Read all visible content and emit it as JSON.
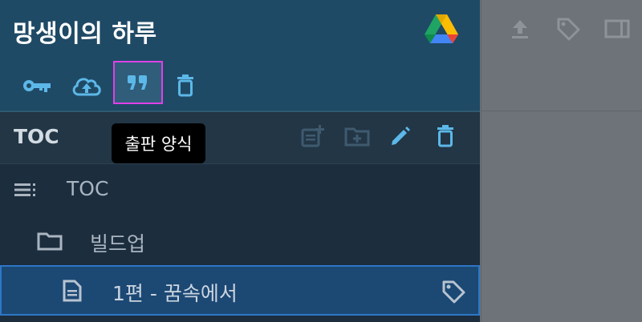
{
  "header": {
    "title": "망생이의 하루"
  },
  "toolbar": {
    "key_icon": "key-icon",
    "upload_icon": "cloud-upload-icon",
    "quote_icon": "format-quote-icon",
    "trash_icon": "trash-icon"
  },
  "tooltip": {
    "text": "출판 양식"
  },
  "toc": {
    "label": "TOC",
    "actions": [
      "note-plus-icon",
      "folder-plus-icon",
      "pencil-icon",
      "trash-icon"
    ]
  },
  "tree": {
    "items": [
      {
        "label": "TOC",
        "icon": "list-icon"
      },
      {
        "label": "빌드업",
        "icon": "folder-icon"
      },
      {
        "label": "1편 - 꿈속에서",
        "icon": "document-icon",
        "selected": true
      }
    ]
  },
  "right_toolbar": {
    "icons": [
      "upload-icon",
      "tag-icon",
      "panel-icon"
    ]
  },
  "colors": {
    "header_bg": "#1f4a66",
    "sidebar_bg": "#1c2d3e",
    "accent": "#5cb8e8",
    "selected_bg": "#1c4874",
    "selected_border": "#2c77c7",
    "highlight_border": "#e040e8",
    "right_pane_bg": "#6d7379"
  }
}
